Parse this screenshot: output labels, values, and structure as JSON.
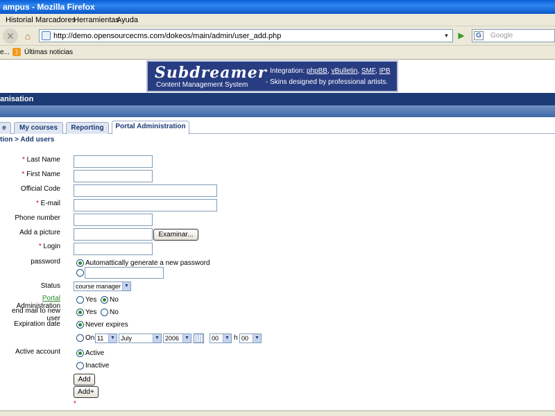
{
  "window": {
    "title": "ampus - Mozilla Firefox"
  },
  "menu": {
    "items": [
      "Historial",
      "Marcadores",
      "Herramientas",
      "Ayuda"
    ]
  },
  "nav": {
    "url": "http://demo.opensourcecms.com/dokeos/main/admin/user_add.php",
    "search_placeholder": "Google"
  },
  "bookmarks": {
    "first": "e...",
    "news": "Últimas noticias"
  },
  "banner": {
    "logo": "Subdreamer",
    "subtitle": "Content Management System",
    "line1_prefix": "- Integration: ",
    "links": [
      "phpBB",
      "vBulletin",
      "SMF",
      "IPB"
    ],
    "line2": "- Skins designed by professional artists."
  },
  "org": {
    "name": "anisation"
  },
  "tabs": [
    "e",
    "My courses",
    "Reporting",
    "Portal Administration"
  ],
  "breadcrumb": "tion > Add users",
  "form": {
    "last_name": "Last Name",
    "first_name": "First Name",
    "official_code": "Official Code",
    "email": "E-mail",
    "phone": "Phone number",
    "picture": "Add a picture",
    "browse": "Examinar...",
    "login": "Login",
    "password": "password",
    "auto_password": "Automattically generate a new password",
    "status": "Status",
    "status_value": "course manager",
    "portal_word": "Portal",
    "portal_rest": " Administration",
    "send_mail": "end mail to new user",
    "yes": "Yes",
    "no": "No",
    "expiration": "Expiration date",
    "never_expires": "Never expires",
    "on": "On",
    "day": "11",
    "month": "July",
    "year": "2006",
    "hour": "00",
    "h": "h",
    "minute": "00",
    "active_account": "Active account",
    "active": "Active",
    "inactive": "Inactive",
    "add": "Add",
    "add_plus": "Add+",
    "required_star": "*"
  }
}
